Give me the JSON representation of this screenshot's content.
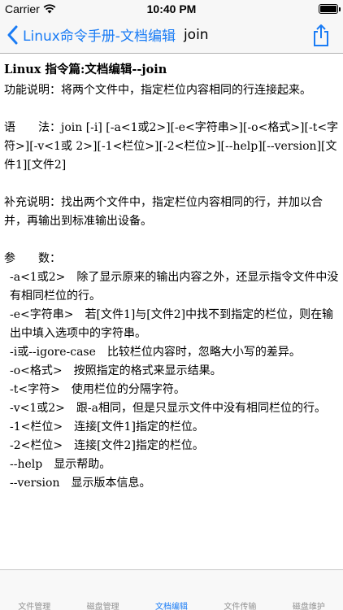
{
  "status_bar": {
    "carrier": "Carrier",
    "time": "10:40 PM"
  },
  "nav": {
    "back_title": "Linux命令手册-文档编辑",
    "title": "join"
  },
  "article": {
    "heading": "Linux 指令篇:文档编辑--join",
    "description": "功能说明：将两个文件中，指定栏位内容相同的行连接起来。",
    "syntax": "语　　法：join [-i] [-a<1或2>][-e<字符串>][-o<格式>][-t<字符>][-v<1或 2>][-1<栏位>][-2<栏位>][--help][--version][文件1][文件2]",
    "supplement": "补充说明：找出两个文件中，指定栏位内容相同的行，并加以合并，再输出到标准输出设备。",
    "params_label": "参　　数：",
    "params": [
      "-a<1或2>　除了显示原来的输出内容之外，还显示指令文件中没有相同栏位的行。",
      "-e<字符串>　若[文件1]与[文件2]中找不到指定的栏位，则在输出中填入选项中的字符串。",
      "-i或--igore-case　比较栏位内容时，忽略大小写的差异。",
      "-o<格式>　按照指定的格式来显示结果。",
      "-t<字符>　使用栏位的分隔字符。",
      "-v<1或2>　跟-a相同，但是只显示文件中没有相同栏位的行。",
      "-1<栏位>　连接[文件1]指定的栏位。",
      "-2<栏位>　连接[文件2]指定的栏位。",
      "--help　显示帮助。",
      "--version　显示版本信息。"
    ]
  },
  "tabs": [
    "文件管理",
    "磁盘管理",
    "文档编辑",
    "文件传输",
    "磁盘维护"
  ],
  "active_tab": "文档编辑",
  "colors": {
    "accent": "#1a7cf5",
    "inactive_tab": "#929292"
  },
  "icons": {
    "wifi": "wifi-icon",
    "back": "chevron-left-icon",
    "share": "share-icon",
    "battery": "battery-icon"
  }
}
